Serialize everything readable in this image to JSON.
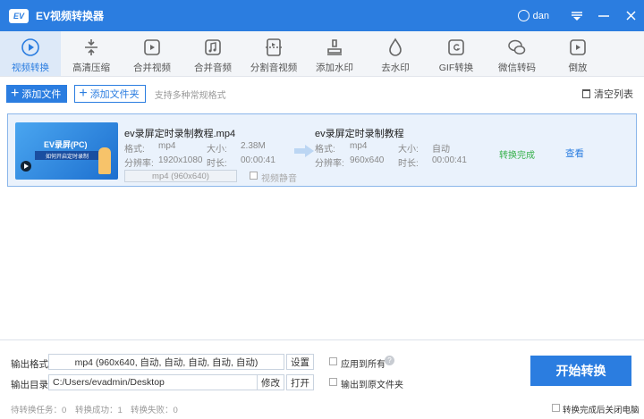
{
  "app": {
    "logo_text": "EV",
    "title": "EV视频转换器",
    "user": "dan"
  },
  "window": {
    "menu_icon": "menu-icon",
    "min_icon": "minimize-icon",
    "close_icon": "close-icon"
  },
  "toolbar": {
    "items": [
      {
        "label": "视频转换",
        "icon": "video-convert-icon",
        "active": true
      },
      {
        "label": "高清压缩",
        "icon": "compress-icon"
      },
      {
        "label": "合并视频",
        "icon": "merge-video-icon"
      },
      {
        "label": "合并音频",
        "icon": "merge-audio-icon"
      },
      {
        "label": "分割音视频",
        "icon": "split-icon"
      },
      {
        "label": "添加水印",
        "icon": "stamp-icon"
      },
      {
        "label": "去水印",
        "icon": "drop-icon"
      },
      {
        "label": "GIF转换",
        "icon": "gif-icon"
      },
      {
        "label": "微信转码",
        "icon": "wechat-icon"
      },
      {
        "label": "倒放",
        "icon": "reverse-icon"
      }
    ]
  },
  "actions": {
    "add_file": "添加文件",
    "add_folder": "添加文件夹",
    "hint": "支持多种常规格式",
    "clear_list": "清空列表"
  },
  "file_item": {
    "thumb_title": "EV录屏(PC)",
    "thumb_subtitle": "如何开启定时录制",
    "source": {
      "name": "ev录屏定时录制教程.mp4",
      "format_label": "格式:",
      "format": "mp4",
      "size_label": "大小:",
      "size": "2.38M",
      "resolution_label": "分辨率:",
      "resolution": "1920x1080",
      "duration_label": "时长:",
      "duration": "00:00:41"
    },
    "preset": "mp4 (960x640)",
    "mute_label": "视频静音",
    "output": {
      "name": "ev录屏定时录制教程",
      "format_label": "格式:",
      "format": "mp4",
      "size_label": "大小:",
      "size": "自动",
      "resolution_label": "分辨率:",
      "resolution": "960x640",
      "duration_label": "时长:",
      "duration": "00:00:41"
    },
    "status": "转换完成",
    "view": "查看"
  },
  "bottom": {
    "format_label": "输出格式",
    "format_value": "mp4 (960x640, 自动, 自动, 自动, 自动, 自动)",
    "settings": "设置",
    "apply_all": "应用到所有",
    "help": "?",
    "dir_label": "输出目录",
    "dir_value": "C:/Users/evadmin/Desktop",
    "modify": "修改",
    "open": "打开",
    "to_source": "输出到原文件夹",
    "start": "开始转换",
    "shutdown": "转换完成后关闭电脑",
    "pending": "待转换任务：0",
    "success": "转换成功：1",
    "failed": "转换失败：0"
  },
  "colors": {
    "accent": "#2b7de0",
    "success": "#36b04a"
  }
}
